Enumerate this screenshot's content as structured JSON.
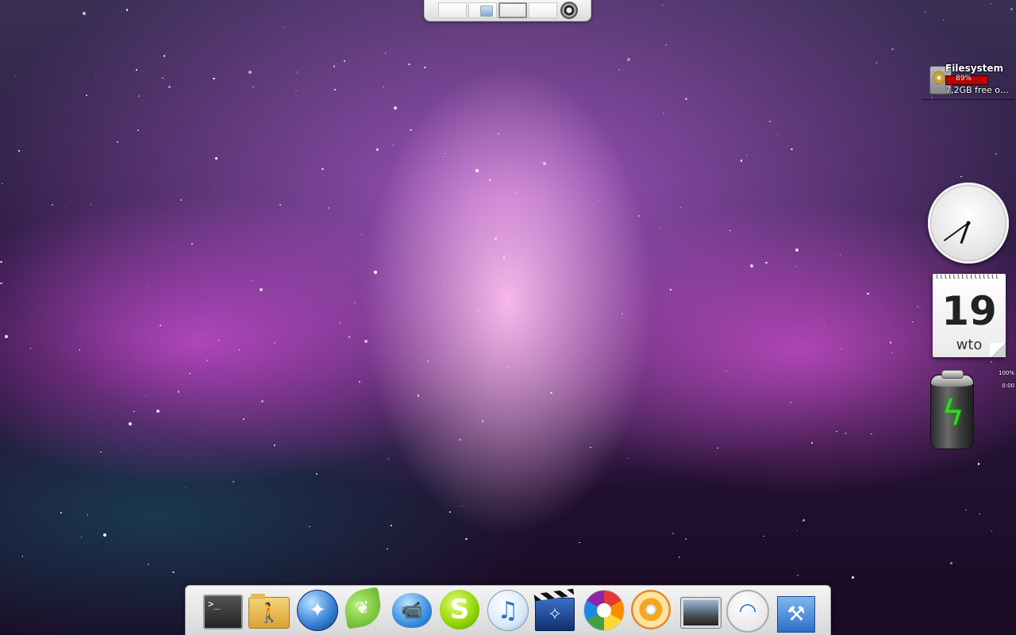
{
  "pager": {
    "workspaces": [
      {
        "name": "workspace-1",
        "active": false
      },
      {
        "name": "workspace-2",
        "active": false
      },
      {
        "name": "workspace-3",
        "active": true
      },
      {
        "name": "workspace-4",
        "active": false
      }
    ],
    "button_icon": "eye-icon"
  },
  "filesystem": {
    "title": "Filesystem",
    "used_percent_label": "89%",
    "used_fraction": 0.89,
    "free_label": "7,2GB free o…",
    "icon": "hard-drive-icon"
  },
  "clock": {
    "hour": 6,
    "minute": 39
  },
  "calendar": {
    "day": "19",
    "weekday": "wto"
  },
  "battery": {
    "percent_label": "100%",
    "time_label": "0:00",
    "status_icon": "charging-bolt-icon",
    "accent": "#37d12b"
  },
  "dock": {
    "items": [
      {
        "name": "terminal",
        "icon": "terminal-icon",
        "glyph": ">_"
      },
      {
        "name": "home-folder",
        "icon": "folder-icon",
        "glyph": "🚶"
      },
      {
        "name": "web-browser",
        "icon": "globe-icon",
        "glyph": "✦"
      },
      {
        "name": "leaf-app",
        "icon": "leaf-icon",
        "glyph": "❦"
      },
      {
        "name": "video-chat",
        "icon": "chat-bubble-icon",
        "glyph": "📹"
      },
      {
        "name": "skype",
        "icon": "skype-icon",
        "glyph": "S"
      },
      {
        "name": "music-player",
        "icon": "music-note-icon",
        "glyph": "♫"
      },
      {
        "name": "movie-editor",
        "icon": "clapperboard-icon",
        "glyph": "✧"
      },
      {
        "name": "photo-viewer",
        "icon": "picasa-icon",
        "glyph": ""
      },
      {
        "name": "dvd-player",
        "icon": "dvd-icon",
        "glyph": ""
      },
      {
        "name": "screen-preview",
        "icon": "display-icon",
        "glyph": ""
      },
      {
        "name": "wifi-manager",
        "icon": "wifi-icon",
        "glyph": "◠"
      },
      {
        "name": "developer-tools",
        "icon": "hammer-icon",
        "glyph": "⚒"
      }
    ]
  },
  "colors": {
    "aurora_pink": "#f39be6",
    "deep_purple": "#2b1740",
    "dock_bg": "#e8e8e8"
  }
}
